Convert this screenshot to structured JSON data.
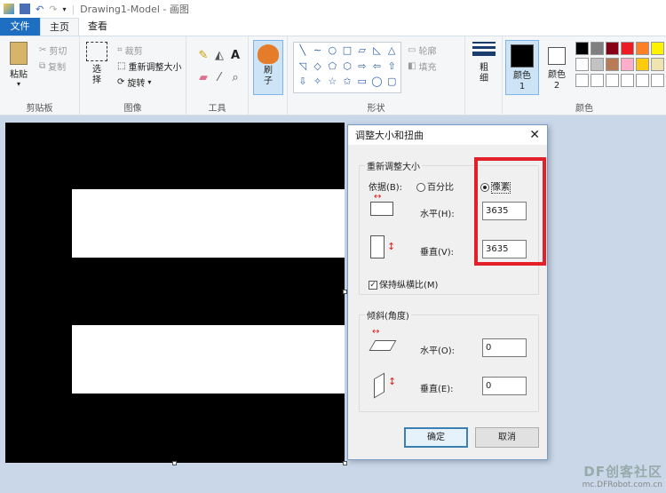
{
  "window": {
    "title": "Drawing1-Model - 画图"
  },
  "tabs": [
    {
      "label": "文件"
    },
    {
      "label": "主页"
    },
    {
      "label": "查看"
    }
  ],
  "ribbon": {
    "clipboard": {
      "paste": "粘贴",
      "cut": "剪切",
      "copy": "复制",
      "group": "剪贴板"
    },
    "image": {
      "select": "选择",
      "crop": "裁剪",
      "resize": "重新调整大小",
      "rotate": "旋转",
      "group": "图像"
    },
    "tools": {
      "group": "工具"
    },
    "brushes": {
      "label": "刷子"
    },
    "shapes": {
      "outline": "轮廓",
      "fill": "填充",
      "group": "形状",
      "glyphs": [
        "╲",
        "∼",
        "○",
        "□",
        "▱",
        "◺",
        "△",
        "◹",
        "◇",
        "⬠",
        "⬡",
        "⇨",
        "⇦",
        "⇧",
        "⇩",
        "✧",
        "☆",
        "✩",
        "▭",
        "◯",
        "▢"
      ]
    },
    "size": {
      "label": "粗细"
    },
    "color1": {
      "label": "颜色 1",
      "value": "#000000"
    },
    "color2": {
      "label": "颜色 2",
      "value": "#ffffff"
    },
    "colors": {
      "group": "颜色",
      "palette": [
        "#000000",
        "#7f7f7f",
        "#880015",
        "#ed1c24",
        "#ff7f27",
        "#fff200",
        "#ffffff",
        "#c3c3c3",
        "#b97a57",
        "#ffaec9",
        "#ffc90e",
        "#efe4b0",
        "#ffffff",
        "#ffffff",
        "#ffffff",
        "#ffffff",
        "#ffffff",
        "#ffffff"
      ]
    }
  },
  "dialog": {
    "title": "调整大小和扭曲",
    "resize_section": "重新调整大小",
    "by_label": "依据(B):",
    "percent": "百分比",
    "pixels": "像素",
    "horizontal_label": "水平(H):",
    "horizontal_value": "3635",
    "vertical_label": "垂直(V):",
    "vertical_value": "3635",
    "keep_ratio": "保持纵横比(M)",
    "skew_section": "倾斜(角度)",
    "skew_h_label": "水平(O):",
    "skew_h_value": "0",
    "skew_v_label": "垂直(E):",
    "skew_v_value": "0",
    "ok": "确定",
    "cancel": "取消"
  },
  "watermark": {
    "text": "DF创客社区",
    "url": "mc.DFRobot.com.cn"
  }
}
